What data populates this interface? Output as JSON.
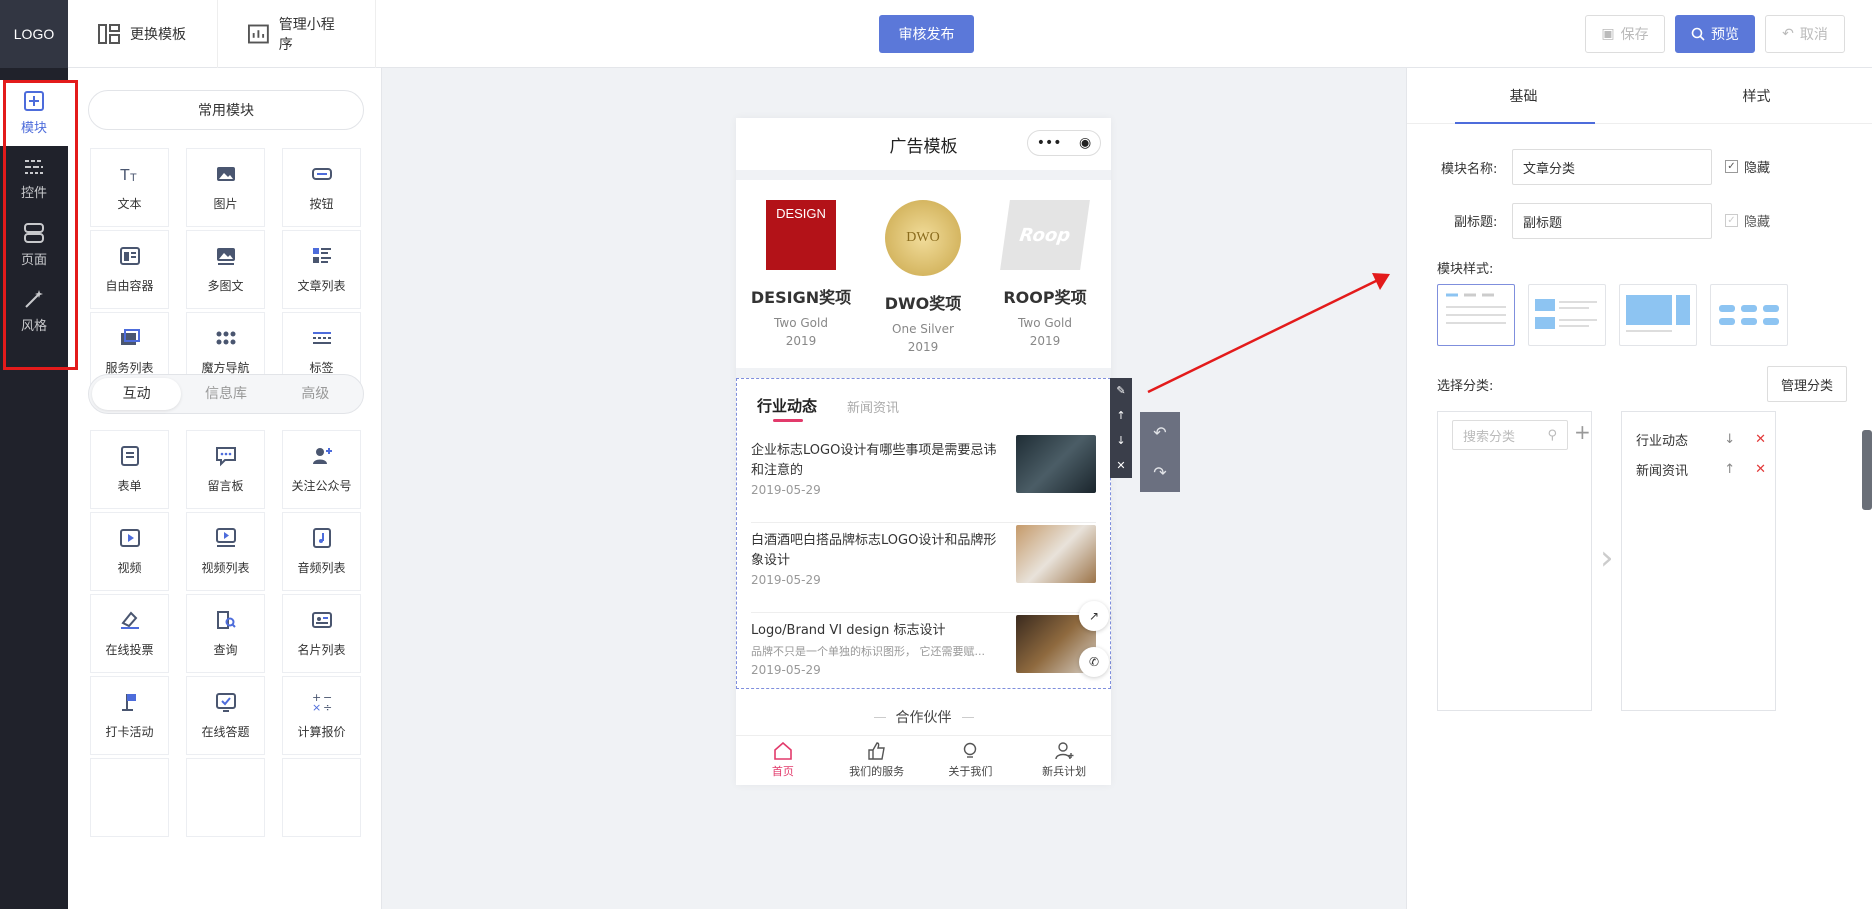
{
  "app": {
    "logo": "LOGO",
    "nav_change_template": "更换模板",
    "nav_manage": "管理小程序",
    "publish": "审核发布",
    "save": "保存",
    "preview": "预览",
    "cancel": "取消"
  },
  "sidenav": [
    {
      "label": "模块",
      "icon": "plus-square-icon",
      "active": true
    },
    {
      "label": "控件",
      "icon": "sliders-icon",
      "active": false
    },
    {
      "label": "页面",
      "icon": "pages-icon",
      "active": false
    },
    {
      "label": "风格",
      "icon": "magic-wand-icon",
      "active": false
    }
  ],
  "left": {
    "common_title": "常用模块",
    "common": [
      "文本",
      "图片",
      "按钮",
      "自由容器",
      "多图文",
      "文章列表",
      "服务列表",
      "魔方导航",
      "标签"
    ],
    "tabs": [
      "互动",
      "信息库",
      "高级"
    ],
    "interactive": [
      "表单",
      "留言板",
      "关注公众号",
      "视频",
      "视频列表",
      "音频列表",
      "在线投票",
      "查询",
      "名片列表",
      "打卡活动",
      "在线答题",
      "计算报价"
    ]
  },
  "phone": {
    "title": "广告模板",
    "awards": [
      {
        "name": "DESIGN奖项",
        "line1": "Two Gold",
        "line2": "2019",
        "badge": "DESIGN"
      },
      {
        "name": "DWO奖项",
        "line1": "One Silver",
        "line2": "2019",
        "badge": "DWO"
      },
      {
        "name": "ROOP奖项",
        "line1": "Two Gold",
        "line2": "2019",
        "badge": "Roop"
      }
    ],
    "news_tabs": [
      "行业动态",
      "新闻资讯"
    ],
    "news": [
      {
        "title": "企业标志LOGO设计有哪些事项是需要忌讳和注意的",
        "sub": "",
        "date": "2019-05-29"
      },
      {
        "title": "白酒酒吧白搭品牌标志LOGO设计和品牌形象设计",
        "sub": "",
        "date": "2019-05-29"
      },
      {
        "title": "Logo/Brand VI design 标志设计",
        "sub": "品牌不只是一个单独的标识图形，  它还需要赋...",
        "date": "2019-05-29"
      }
    ],
    "partner": "合作伙伴",
    "bottom": [
      "首页",
      "我们的服务",
      "关于我们",
      "新兵计划"
    ]
  },
  "right": {
    "tabs": [
      "基础",
      "样式"
    ],
    "module_name_label": "模块名称:",
    "module_name_value": "文章分类",
    "subtitle_label": "副标题:",
    "subtitle_value": "副标题",
    "hide_label": "隐藏",
    "style_label": "模块样式:",
    "category_label": "选择分类:",
    "manage_category": "管理分类",
    "search_placeholder": "搜索分类",
    "selected": [
      "行业动态",
      "新闻资讯"
    ]
  },
  "colors": {
    "accent": "#5b78d9",
    "sidebar": "#20222b",
    "highlight": "#e31b1b",
    "pink": "#e23a6b"
  }
}
